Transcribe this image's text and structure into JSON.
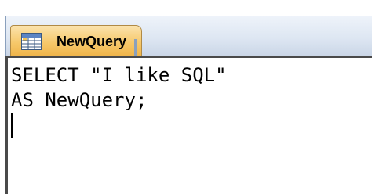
{
  "tab": {
    "title": "NewQuery",
    "icon": "query-grid-icon"
  },
  "editor": {
    "lines": [
      "SELECT \"I like SQL\"",
      "AS NewQuery;"
    ]
  },
  "colors": {
    "tab_active": "#f6c86a",
    "tabstrip": "#dde6f2",
    "editor_border": "#4a4a4a"
  }
}
